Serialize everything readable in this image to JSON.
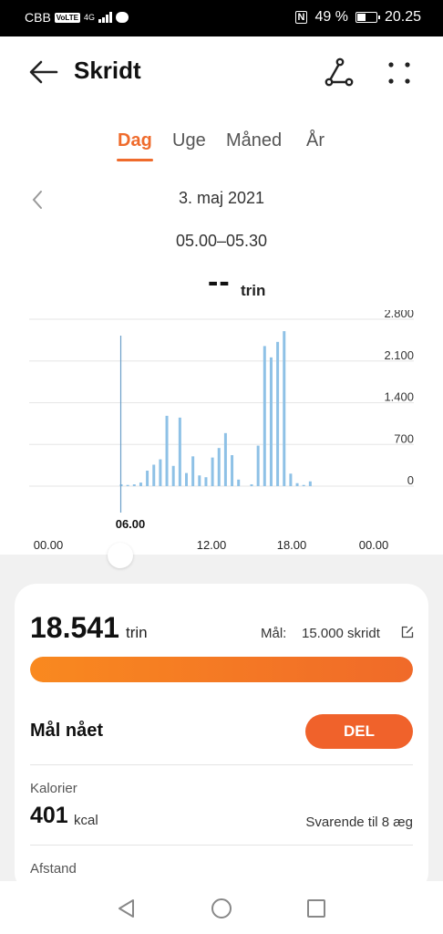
{
  "status_bar": {
    "carrier": "CBB",
    "volte": "VoLTE",
    "network": "4G",
    "battery_text": "49 %",
    "battery_level": 0.49,
    "time": "20.25",
    "nfc": "N"
  },
  "header": {
    "title": "Skridt"
  },
  "tabs": [
    {
      "label": "Dag",
      "active": true
    },
    {
      "label": "Uge"
    },
    {
      "label": "Måned"
    },
    {
      "label": "År"
    }
  ],
  "date": "3. maj 2021",
  "time_range": "05.00–05.30",
  "selected_value": "--",
  "selected_unit": "trin",
  "accent_color": "#ef6b2c",
  "chart_data": {
    "type": "bar",
    "x_label_ticks": [
      "00.00",
      "06.00",
      "12.00",
      "18.00",
      "00.00"
    ],
    "selected_tick": "06.00",
    "y_ticks": [
      "2.800",
      "2.100",
      "1.400",
      "700",
      "0"
    ],
    "ylim": [
      0,
      2800
    ],
    "x_unit": "half-hour slot of day",
    "bar_color": "#8ec1e6",
    "values": [
      {
        "slot": 12,
        "steps": 30
      },
      {
        "slot": 13,
        "steps": 20
      },
      {
        "slot": 14,
        "steps": 30
      },
      {
        "slot": 15,
        "steps": 60
      },
      {
        "slot": 16,
        "steps": 260
      },
      {
        "slot": 17,
        "steps": 360
      },
      {
        "slot": 18,
        "steps": 450
      },
      {
        "slot": 19,
        "steps": 1180
      },
      {
        "slot": 20,
        "steps": 340
      },
      {
        "slot": 21,
        "steps": 1150
      },
      {
        "slot": 22,
        "steps": 220
      },
      {
        "slot": 23,
        "steps": 500
      },
      {
        "slot": 24,
        "steps": 180
      },
      {
        "slot": 25,
        "steps": 150
      },
      {
        "slot": 26,
        "steps": 480
      },
      {
        "slot": 27,
        "steps": 640
      },
      {
        "slot": 28,
        "steps": 890
      },
      {
        "slot": 29,
        "steps": 520
      },
      {
        "slot": 30,
        "steps": 110
      },
      {
        "slot": 32,
        "steps": 30
      },
      {
        "slot": 33,
        "steps": 680
      },
      {
        "slot": 34,
        "steps": 2350
      },
      {
        "slot": 35,
        "steps": 2160
      },
      {
        "slot": 36,
        "steps": 2420
      },
      {
        "slot": 37,
        "steps": 2600
      },
      {
        "slot": 38,
        "steps": 210
      },
      {
        "slot": 39,
        "steps": 50
      },
      {
        "slot": 40,
        "steps": 20
      },
      {
        "slot": 41,
        "steps": 80
      }
    ]
  },
  "summary": {
    "total_steps": "18.541",
    "total_unit": "trin",
    "goal_label": "Mål:",
    "goal_value": "15.000 skridt",
    "goal_progress": 1.0,
    "achieved_label": "Mål nået",
    "share_label": "DEL",
    "calories_label": "Kalorier",
    "calories_value": "401",
    "calories_unit": "kcal",
    "calories_equivalent": "Svarende til 8 æg",
    "distance_label": "Afstand"
  },
  "navbar": {
    "back": "back-triangle-icon",
    "home": "home-circle-icon",
    "recent": "recent-square-icon"
  }
}
